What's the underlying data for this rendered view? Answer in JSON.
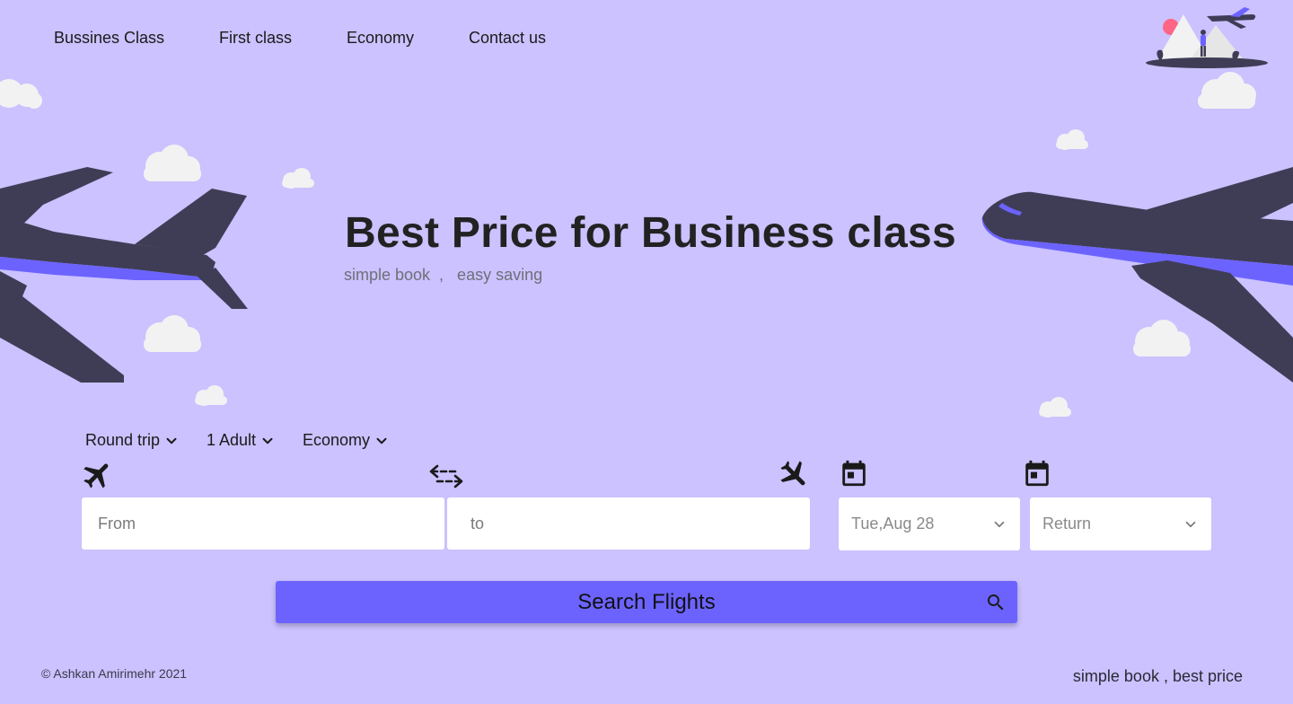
{
  "nav": {
    "items": [
      {
        "label": "Bussines Class"
      },
      {
        "label": "First class"
      },
      {
        "label": "Economy"
      },
      {
        "label": "Contact us"
      }
    ]
  },
  "hero": {
    "title": "Best Price for Business class",
    "subtitle": "simple book  ,   easy saving"
  },
  "search": {
    "trip_type": "Round trip",
    "passengers": "1 Adult",
    "cabin": "Economy",
    "from_placeholder": "From",
    "to_placeholder": "to",
    "depart_date": "Tue,Aug 28",
    "return_placeholder": "Return",
    "button_label": "Search Flights"
  },
  "footer": {
    "copyright": "© Ashkan Amirimehr 2021",
    "tagline": "simple book , best price"
  },
  "colors": {
    "background": "#CBC2FF",
    "accent": "#6C63FF",
    "plane_body": "#3F3D56",
    "cloud": "#F2F2F2"
  },
  "icons": [
    "logo-illustration-icon",
    "airplane-icon",
    "cloud-icon",
    "chevron-down-icon",
    "takeoff-icon",
    "swap-arrows-icon",
    "landing-icon",
    "calendar-icon",
    "search-icon"
  ]
}
